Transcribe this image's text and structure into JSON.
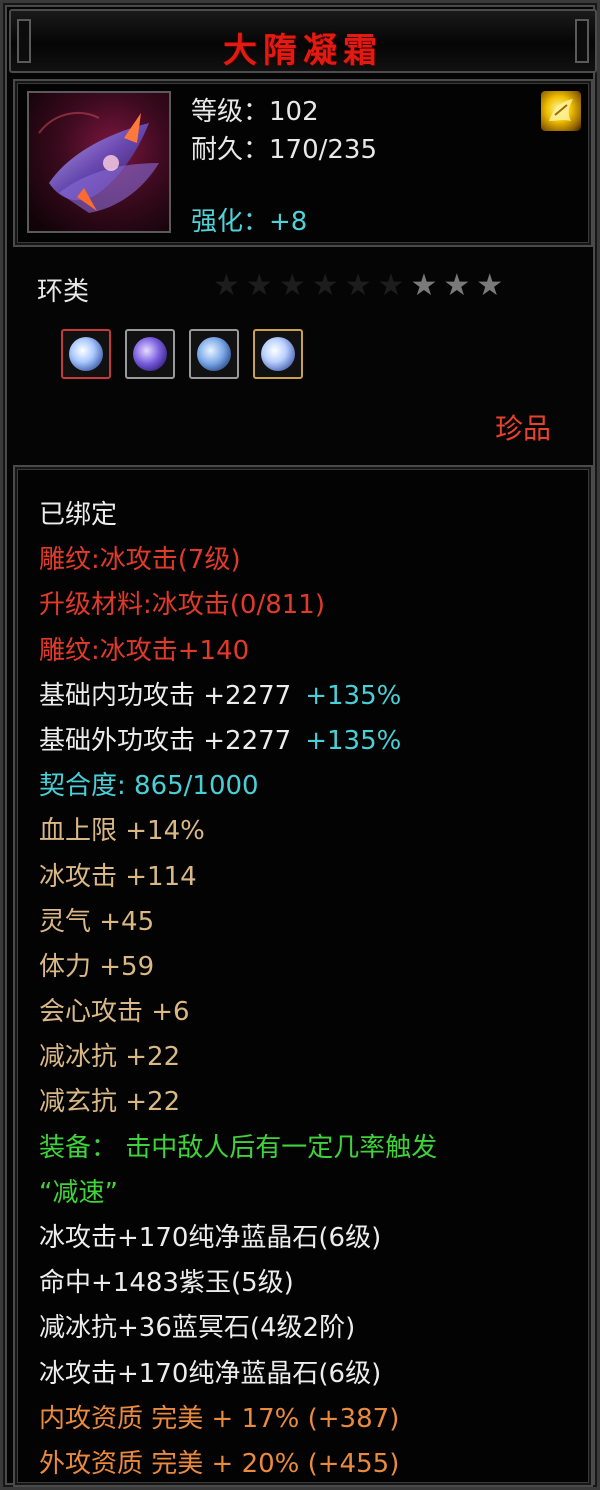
{
  "item": {
    "name": "大隋凝霜",
    "level_label": "等级：102",
    "durability_label": "耐久：170/235",
    "enhance_label": "强化：+8",
    "category": "环类",
    "rarity": "珍品",
    "star_rating": {
      "total": 9,
      "filled": 3
    }
  },
  "gems": [
    {
      "name": "gem-slot-1",
      "frame": "red"
    },
    {
      "name": "gem-slot-2",
      "frame": "grey"
    },
    {
      "name": "gem-slot-3",
      "frame": "grey"
    },
    {
      "name": "gem-slot-4",
      "frame": "gold"
    }
  ],
  "properties": [
    {
      "text": "已绑定",
      "color": "white"
    },
    {
      "text": "雕纹:冰攻击(7级)",
      "color": "red"
    },
    {
      "text": "升级材料:冰攻击(0/811)",
      "color": "red"
    },
    {
      "text": "雕纹:冰攻击+140",
      "color": "red"
    },
    {
      "text": "基础内功攻击 +2277",
      "extra": "+135%",
      "color": "white",
      "extra_color": "cyan"
    },
    {
      "text": "基础外功攻击 +2277",
      "extra": "+135%",
      "color": "white",
      "extra_color": "cyan"
    },
    {
      "text": "契合度: 865/1000",
      "color": "cyan"
    },
    {
      "text": "血上限 +14%",
      "color": "tan"
    },
    {
      "text": "冰攻击 +114",
      "color": "tan"
    },
    {
      "text": "灵气 +45",
      "color": "tan"
    },
    {
      "text": "体力 +59",
      "color": "tan"
    },
    {
      "text": "会心攻击 +6",
      "color": "tan"
    },
    {
      "text": "减冰抗 +22",
      "color": "tan"
    },
    {
      "text": "减玄抗 +22",
      "color": "tan"
    },
    {
      "text": "装备： 击中敌人后有一定几率触发",
      "color": "green"
    },
    {
      "text": "“减速”",
      "color": "green"
    },
    {
      "text": "冰攻击+170纯净蓝晶石(6级)",
      "color": "white"
    },
    {
      "text": "命中+1483紫玉(5级)",
      "color": "white"
    },
    {
      "text": "减冰抗+36蓝冥石(4级2阶)",
      "color": "white"
    },
    {
      "text": "冰攻击+170纯净蓝晶石(6级)",
      "color": "white"
    },
    {
      "text": "内攻资质 完美 + 17% (+387)",
      "color": "orange"
    },
    {
      "text": "外攻资质 完美 + 20% (+455)",
      "color": "orange"
    }
  ],
  "colors": {
    "title": "#e21a12",
    "white": "#ececec",
    "red": "#e23a2a",
    "tan": "#d9b885",
    "cyan": "#49cfd6",
    "green": "#3fd23a",
    "orange": "#e98a3e"
  }
}
